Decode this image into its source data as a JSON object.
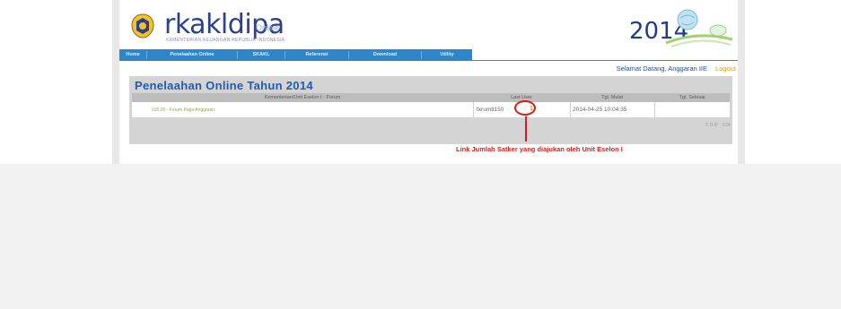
{
  "header": {
    "logo_text": "rkakldipa",
    "logo_sub": "Online",
    "ministry": "KEMENTERIAN KEUANGAN REPUBLIK INDONESIA",
    "year": "2014"
  },
  "nav": {
    "items": [
      {
        "label": "Home"
      },
      {
        "label": "Penelaahan Online"
      },
      {
        "label": "SKAKL"
      },
      {
        "label": "Referensi"
      },
      {
        "label": "Download"
      },
      {
        "label": "Utility"
      }
    ]
  },
  "welcome": {
    "text": "Selamat Datang, Anggaran IIE",
    "logout": "Logout"
  },
  "panel": {
    "title": "Penelaahan Online Tahun 2014",
    "columns": [
      "Kementerian/Unit Eselon I - Forum",
      "Last User",
      "Tgl. Mulai",
      "Tgl. Selesai"
    ],
    "rows": [
      {
        "forum": "015.05 - Forum Pagu Anggaran",
        "last_user": "fxrumtl150",
        "count": "1",
        "start": "2014-04-25 10:04:35",
        "end": ""
      }
    ],
    "copyright": "© DJP - DJA"
  },
  "annotation": {
    "text": "Link Jumlah Satker yang diajukan oleh Unit Eselon I"
  },
  "colors": {
    "nav_bg": "#2e86c9",
    "title": "#1f5bb5",
    "annotation": "#e01818",
    "logout": "#d89a20"
  }
}
